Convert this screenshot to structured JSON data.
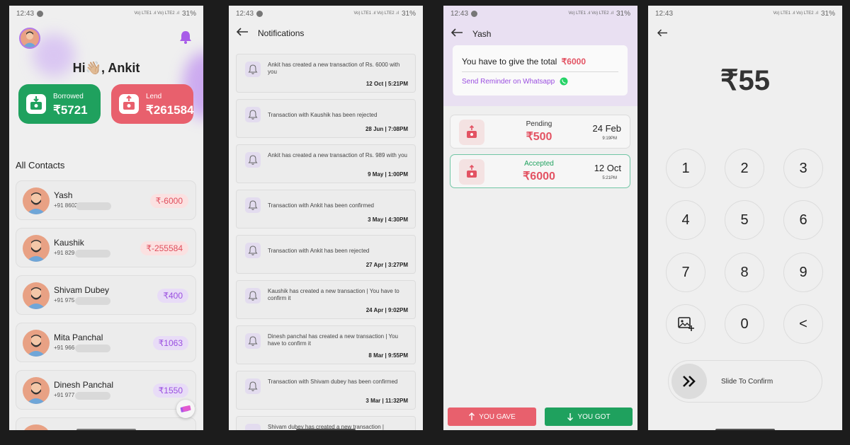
{
  "status": {
    "time": "12:43",
    "battery": "31%",
    "net": "Vo) LTE1 .ıl Vo) LTE2 .ıl"
  },
  "home": {
    "greeting_hi": "Hi",
    "greeting_name": "👋🏼, Ankit",
    "borrowed_label": "Borrowed",
    "borrowed_amount": "₹5721",
    "lend_label": "Lend",
    "lend_amount": "₹261584",
    "contacts_title": "All Contacts",
    "contacts": [
      {
        "name": "Yash",
        "phone": "+91 8602",
        "amount": "₹-6000"
      },
      {
        "name": "Kaushik",
        "phone": "+91 829",
        "amount": "₹-255584"
      },
      {
        "name": "Shivam Dubey",
        "phone": "+91 975",
        "amount": "₹400"
      },
      {
        "name": "Mita Panchal",
        "phone": "+91 966",
        "amount": "₹1063"
      },
      {
        "name": "Dinesh Panchal",
        "phone": "+91 977",
        "amount": "₹1550"
      }
    ]
  },
  "notifications": {
    "title": "Notifications",
    "items": [
      {
        "text": "Ankit has created a new transaction of Rs. 6000 with you",
        "date": "12 Oct | 5:21PM"
      },
      {
        "text": "Transaction with Kaushik  has been rejected",
        "date": "28 Jun | 7:08PM"
      },
      {
        "text": "Ankit has created a new transaction of Rs. 989 with you",
        "date": "9 May | 1:00PM"
      },
      {
        "text": "Transaction with Ankit has been confirmed",
        "date": "3 May | 4:30PM"
      },
      {
        "text": "Transaction with Ankit has been rejected",
        "date": "27 Apr | 3:27PM"
      },
      {
        "text": "Kaushik  has created a new transaction | You have to confirm it",
        "date": "24 Apr | 9:02PM"
      },
      {
        "text": "Dinesh panchal  has created a new transaction | You have to confirm it",
        "date": "8 Mar | 9:55PM"
      },
      {
        "text": "Transaction with Shivam dubey  has been confirmed",
        "date": "3 Mar | 11:32PM"
      },
      {
        "text": "Shivam dubey  has created a new transaction |",
        "date": ""
      }
    ]
  },
  "detail": {
    "name": "Yash",
    "give_text": "You have to give the total",
    "give_amount": "₹6000",
    "reminder": "Send Reminder on Whatsapp",
    "transactions": [
      {
        "status": "Pending",
        "amount": "₹500",
        "date": "24 Feb",
        "time": "9:19PM"
      },
      {
        "status": "Accepted",
        "amount": "₹6000",
        "date": "12 Oct",
        "time": "5:21PM"
      }
    ],
    "gave_label": "YOU GAVE",
    "got_label": "YOU GOT"
  },
  "keypad": {
    "amount": "₹55",
    "keys": [
      "1",
      "2",
      "3",
      "4",
      "5",
      "6",
      "7",
      "8",
      "9",
      "0",
      "<"
    ],
    "slide_label": "Slide To Confirm"
  },
  "colors": {
    "green": "#1fa15e",
    "red": "#e8606d",
    "purple": "#9a4fe0",
    "whatsapp": "#25d366"
  }
}
